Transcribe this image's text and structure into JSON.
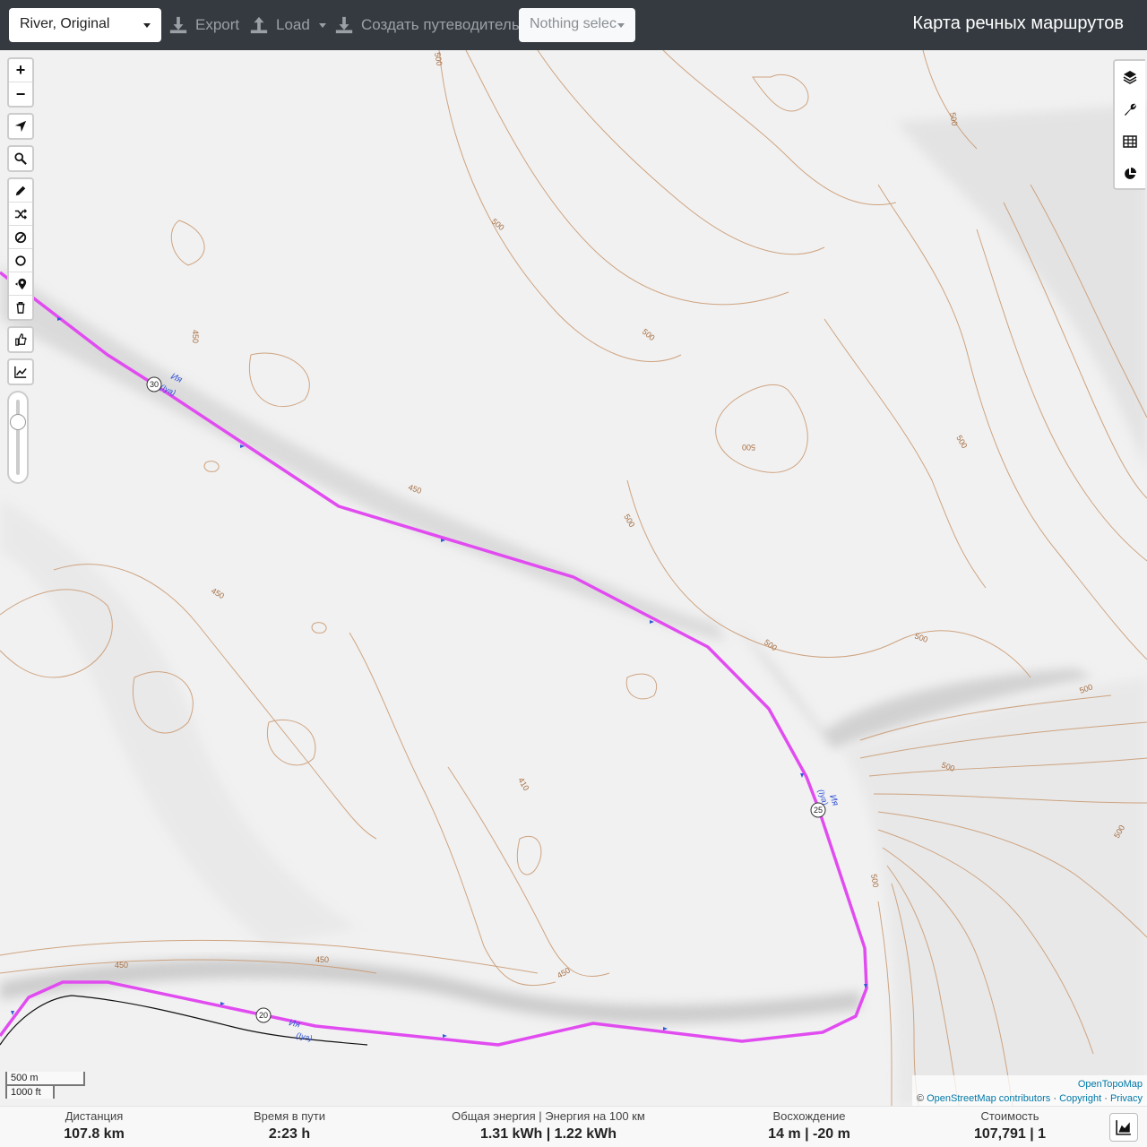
{
  "header": {
    "profile": "River, Original",
    "export_label": "Export",
    "load_label": "Load",
    "guide_label": "Создать путеводитель",
    "guide_select": "Nothing selec",
    "brand": "Карта речных маршрутов"
  },
  "map_controls": {
    "zoom_in": "+",
    "zoom_out": "−"
  },
  "map": {
    "river_labels": [
      {
        "name": "Ия",
        "latin": "(Iya)"
      },
      {
        "name": "Ия",
        "latin": "(Iya)"
      },
      {
        "name": "Ия",
        "latin": "(Iya)"
      }
    ],
    "km_markers": [
      "30",
      "25",
      "20"
    ],
    "contour_labels": [
      "500",
      "500",
      "500",
      "500",
      "500",
      "500",
      "500",
      "500",
      "500",
      "500",
      "500",
      "500",
      "500",
      "450",
      "450",
      "450",
      "450",
      "450",
      "450",
      "410"
    ],
    "route_color": "#e14cf0",
    "contour_color": "#c9976e"
  },
  "scale": {
    "metric": "500 m",
    "imperial": "1000 ft"
  },
  "attribution": {
    "provider": "OpenTopoMap",
    "osm": "OpenStreetMap contributors",
    "copyright": "Copyright",
    "privacy": "Privacy",
    "copy_sign": "©",
    "sep": "·"
  },
  "stats": {
    "distance": {
      "label": "Дистанция",
      "value": "107.8 km"
    },
    "time": {
      "label": "Время в пути",
      "value": "2:23 h"
    },
    "energy": {
      "label": "Общая энергия | Энергия на 100 км",
      "value": "1.31 kWh | 1.22 kWh"
    },
    "ascent": {
      "label": "Восхождение",
      "value": "14 m | -20 m"
    },
    "cost": {
      "label": "Стоимость",
      "value": "107,791 | 1"
    }
  }
}
